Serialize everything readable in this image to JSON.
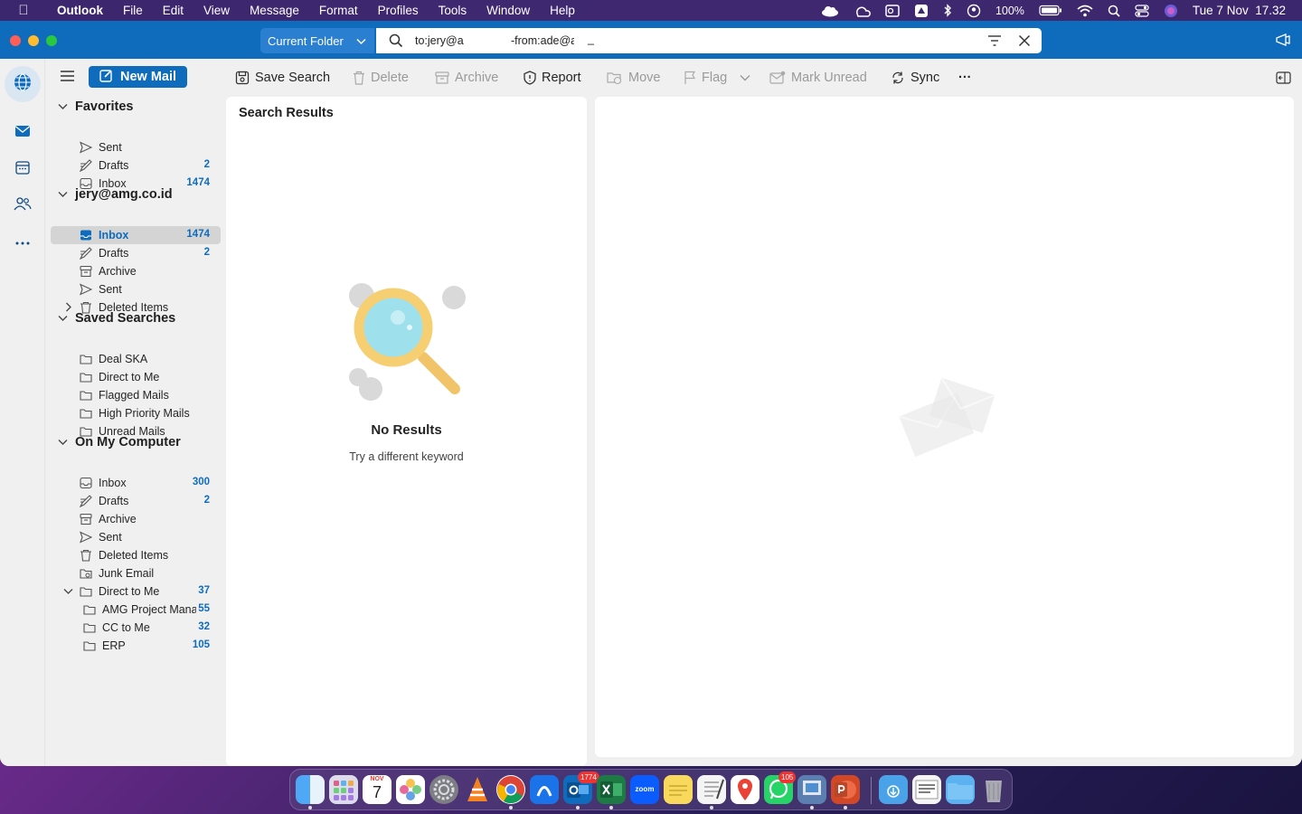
{
  "menubar": {
    "app": "Outlook",
    "items": [
      "File",
      "Edit",
      "View",
      "Message",
      "Format",
      "Profiles",
      "Tools",
      "Window",
      "Help"
    ],
    "battery": "100%",
    "datetime": "Tue 7 Nov  17.32"
  },
  "search": {
    "scope": "Current Folder",
    "query_to": "to:jery@a",
    "query_from": "-from:ade@a",
    "cursor": "_"
  },
  "toolbar": {
    "new_mail": "New Mail",
    "save_search": "Save Search",
    "delete": "Delete",
    "archive": "Archive",
    "report": "Report",
    "move": "Move",
    "flag": "Flag",
    "mark_unread": "Mark Unread",
    "sync": "Sync",
    "more": "···"
  },
  "folders": {
    "favorites": {
      "title": "Favorites",
      "items": [
        {
          "label": "Sent",
          "count": ""
        },
        {
          "label": "Drafts",
          "count": "2"
        },
        {
          "label": "Inbox",
          "count": "1474"
        }
      ]
    },
    "account": {
      "title": "jery@amg.co.id",
      "items": [
        {
          "label": "Inbox",
          "count": "1474"
        },
        {
          "label": "Drafts",
          "count": "2"
        },
        {
          "label": "Archive",
          "count": ""
        },
        {
          "label": "Sent",
          "count": ""
        },
        {
          "label": "Deleted Items",
          "count": ""
        }
      ]
    },
    "saved": {
      "title": "Saved Searches",
      "items": [
        {
          "label": "Deal SKA"
        },
        {
          "label": "Direct to Me"
        },
        {
          "label": "Flagged Mails"
        },
        {
          "label": "High Priority Mails"
        },
        {
          "label": "Unread Mails"
        }
      ]
    },
    "local": {
      "title": "On My Computer",
      "items": [
        {
          "label": "Inbox",
          "count": "300"
        },
        {
          "label": "Drafts",
          "count": "2"
        },
        {
          "label": "Archive",
          "count": ""
        },
        {
          "label": "Sent",
          "count": ""
        },
        {
          "label": "Deleted Items",
          "count": ""
        },
        {
          "label": "Junk Email",
          "count": ""
        },
        {
          "label": "Direct to Me",
          "count": "37"
        },
        {
          "label": "AMG Project Mana",
          "count": "55"
        },
        {
          "label": "CC to Me",
          "count": "32"
        },
        {
          "label": "ERP",
          "count": "105"
        }
      ]
    }
  },
  "list": {
    "header": "Search Results",
    "empty_title": "No Results",
    "empty_subtitle": "Try a different keyword"
  },
  "dock": {
    "calendar_month": "NOV",
    "calendar_day": "7",
    "outlook_badge": "1774",
    "whatsapp_badge": "105",
    "zoom_label": "zoom"
  },
  "colors": {
    "accent": "#0f6cbd",
    "rail_bg": "#f0f0f0"
  }
}
